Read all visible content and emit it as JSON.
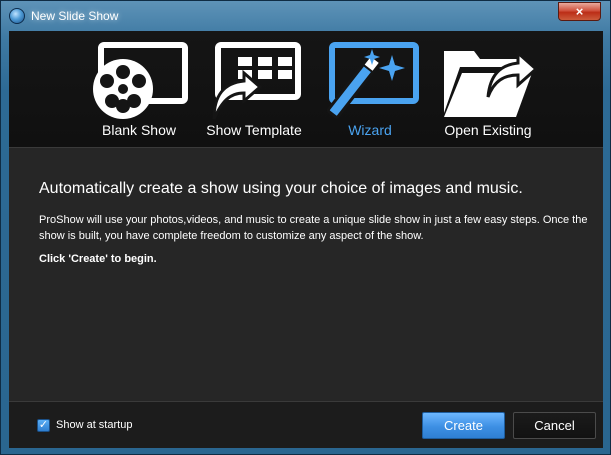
{
  "window": {
    "title": "New Slide Show",
    "close_glyph": "×"
  },
  "modes": [
    {
      "label": "Blank Show",
      "icon": "film-reel-icon",
      "active": false
    },
    {
      "label": "Show Template",
      "icon": "template-icon",
      "active": false
    },
    {
      "label": "Wizard",
      "icon": "magic-wand-icon",
      "active": true
    },
    {
      "label": "Open Existing",
      "icon": "folder-arrow-icon",
      "active": false
    }
  ],
  "content": {
    "headline": "Automatically create a show using your choice of images and music.",
    "description": "ProShow will use your photos,videos, and music to create a unique slide show in just a few easy steps. Once the show is built, you have complete freedom to customize any aspect of the show.",
    "cta": "Click 'Create' to begin."
  },
  "footer": {
    "show_at_startup_label": "Show at startup",
    "show_at_startup_checked": true,
    "check_glyph": "✓",
    "create_label": "Create",
    "cancel_label": "Cancel"
  },
  "colors": {
    "accent": "#4aa3f0",
    "background": "#262626",
    "strip": "#151515"
  }
}
